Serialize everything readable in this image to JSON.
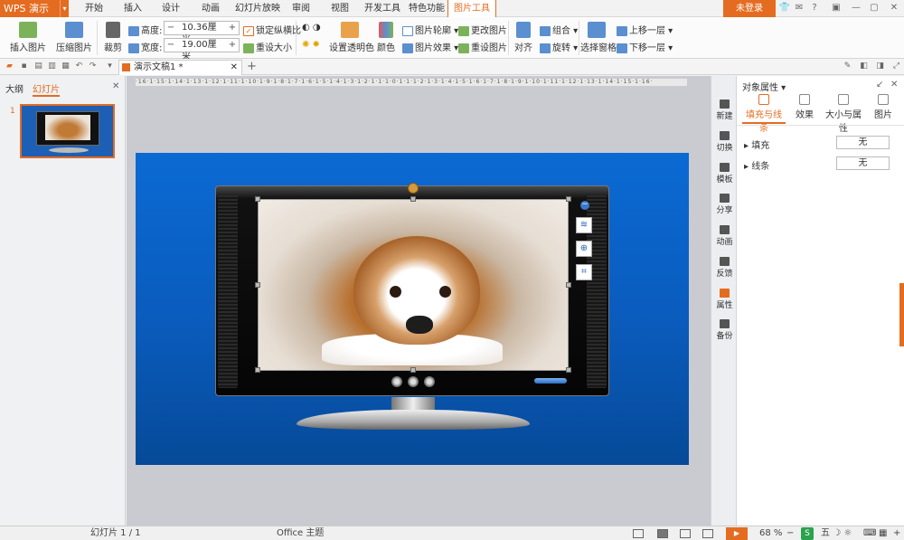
{
  "app": {
    "name": "WPS 演示",
    "login_label": "未登录"
  },
  "menu": {
    "tabs": [
      "开始",
      "插入",
      "设计",
      "动画",
      "幻灯片放映",
      "审阅",
      "视图",
      "开发工具",
      "特色功能",
      "图片工具"
    ],
    "active_tab": "图片工具"
  },
  "ribbon": {
    "insert_picture": "插入图片",
    "compress_picture": "压缩图片",
    "crop": "裁剪",
    "height_label": "高度:",
    "height_value": "10.36厘米",
    "width_label": "宽度:",
    "width_value": "19.00厘米",
    "lock_ratio": "锁定纵横比",
    "reset_size": "重设大小",
    "set_transparent": "设置透明色",
    "color": "颜色",
    "picture_outline": "图片轮廓",
    "picture_effect": "图片效果",
    "change_picture": "更改图片",
    "reset_picture": "重设图片",
    "align": "对齐",
    "group": "组合",
    "rotate": "旋转",
    "selection_pane": "选择窗格",
    "bring_forward": "上移一层",
    "send_backward": "下移一层"
  },
  "document_tab": {
    "title": "演示文稿1 *"
  },
  "left_panel": {
    "tab_outline": "大纲",
    "tab_slides": "幻灯片",
    "slide_number": "1"
  },
  "ruler": {
    "text": "·16·1·15·1·14·1·13·1·12·1·11·1·10·1·9·1·8·1·7·1·6·1·5·1·4·1·3·1·2·1·1·1·0·1·1·1·2·1·3·1·4·1·5·1·6·1·7·1·8·1·9·1·10·1·11·1·12·1·13·1·14·1·15·1·16·"
  },
  "right_tools": [
    {
      "label": "新建",
      "active": false
    },
    {
      "label": "切换",
      "active": false
    },
    {
      "label": "模板",
      "active": false
    },
    {
      "label": "分享",
      "active": false
    },
    {
      "label": "动画",
      "active": false
    },
    {
      "label": "反馈",
      "active": false
    },
    {
      "label": "属性",
      "active": true
    },
    {
      "label": "备份",
      "active": false
    }
  ],
  "properties": {
    "title": "对象属性 ▾",
    "tabs": [
      "填充与线条",
      "效果",
      "大小与属性",
      "图片"
    ],
    "active_tab": "填充与线条",
    "fill_label": "填充",
    "fill_value": "无",
    "line_label": "线条",
    "line_value": "无"
  },
  "statusbar": {
    "slide_info": "幻灯片 1 / 1",
    "theme": "Office 主题",
    "zoom": "68 %"
  },
  "colors": {
    "accent": "#e46c21",
    "slide_top": "#0b6ad3",
    "slide_bottom": "#064a98"
  }
}
